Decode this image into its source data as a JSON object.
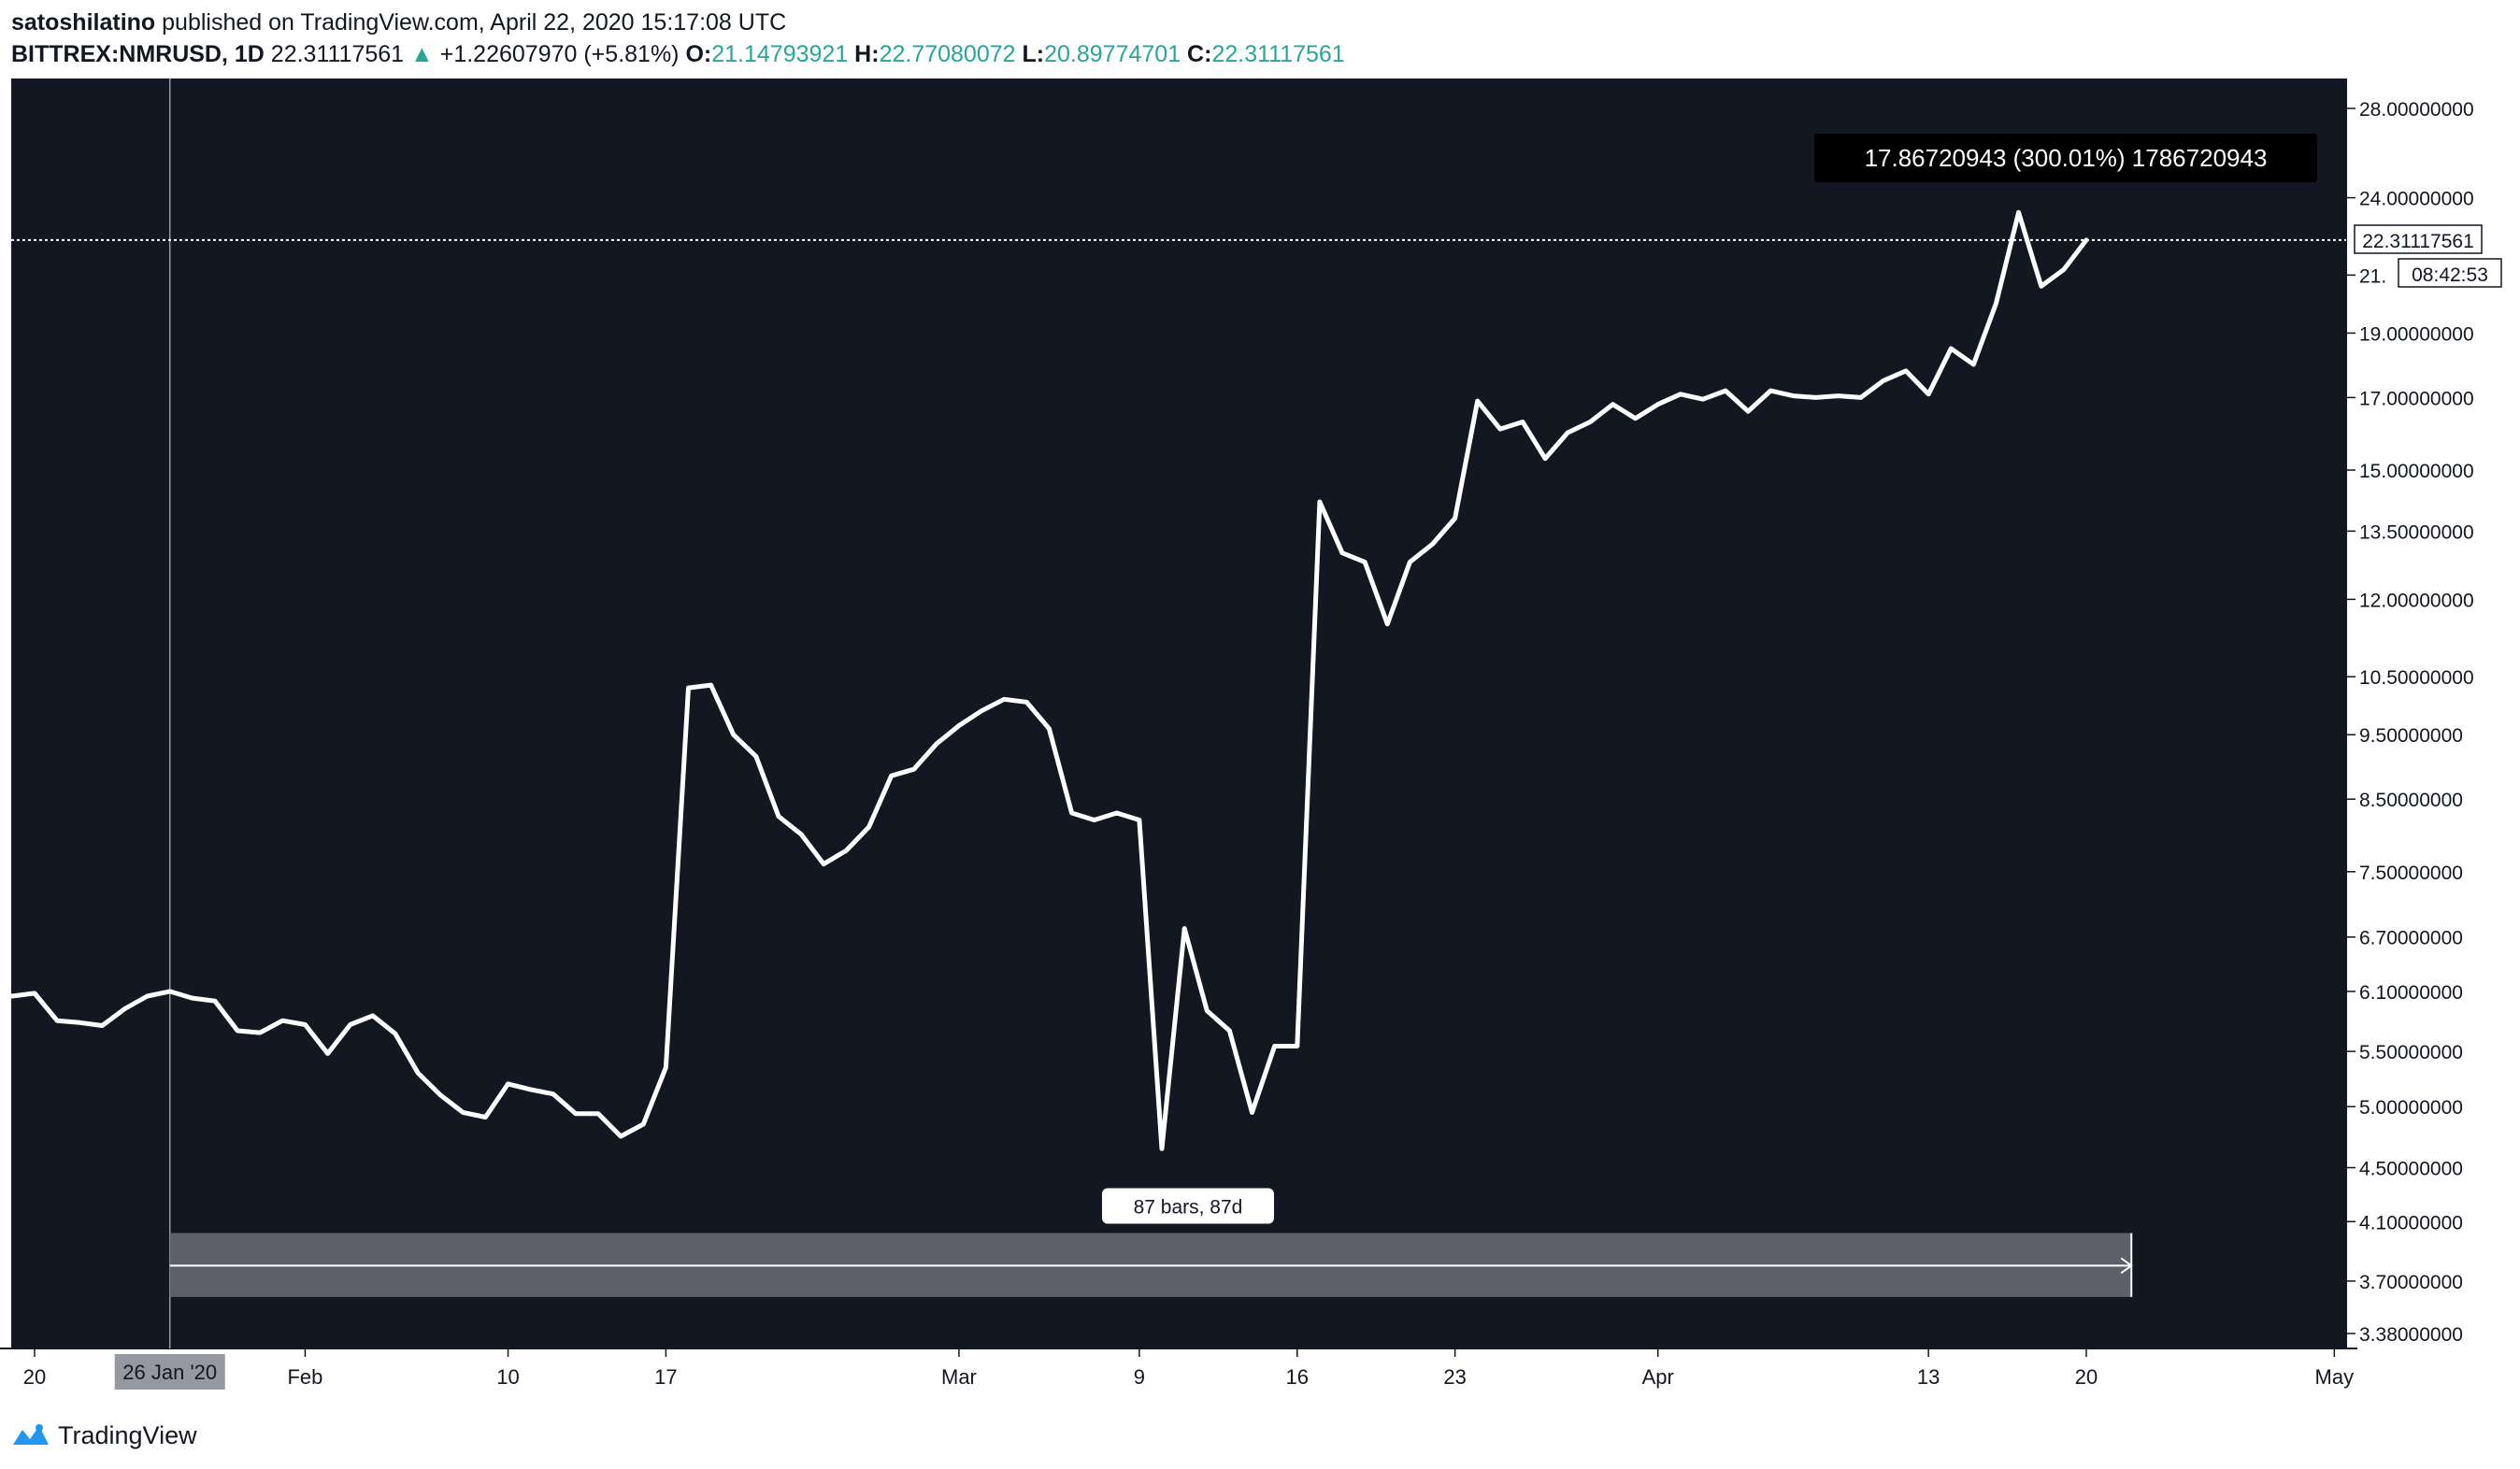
{
  "header": {
    "author": "satoshilatino",
    "published_text": "published on TradingView.com, April 22, 2020 15:17:08 UTC",
    "symbol": "BITTREX:NMRUSD, 1D",
    "last": "22.31117561",
    "change": "+1.22607970 (+5.81%)",
    "o_label": "O:",
    "o_value": "21.14793921",
    "h_label": "H:",
    "h_value": "22.77080072",
    "l_label": "L:",
    "l_value": "20.89774701",
    "c_label": "C:",
    "c_value": "22.31117561"
  },
  "footer": {
    "brand": "TradingView"
  },
  "colors": {
    "chart_bg": "#131722",
    "line": "#ffffff",
    "axis_bg": "#ffffff",
    "positive": "#26a69a",
    "range_fill": "#5d606b",
    "tooltip_bg": "#000000"
  },
  "chart_data": {
    "type": "line",
    "title": "BITTREX:NMRUSD, 1D",
    "xlabel": "",
    "ylabel": "",
    "y_scale": "log",
    "ylim": [
      3.3,
      32
    ],
    "grid": false,
    "x_dates": [
      "2020-01-17",
      "2020-01-18",
      "2020-01-19",
      "2020-01-20",
      "2020-01-21",
      "2020-01-22",
      "2020-01-23",
      "2020-01-24",
      "2020-01-25",
      "2020-01-26",
      "2020-01-27",
      "2020-01-28",
      "2020-01-29",
      "2020-01-30",
      "2020-01-31",
      "2020-02-01",
      "2020-02-02",
      "2020-02-03",
      "2020-02-04",
      "2020-02-05",
      "2020-02-06",
      "2020-02-07",
      "2020-02-08",
      "2020-02-09",
      "2020-02-10",
      "2020-02-11",
      "2020-02-12",
      "2020-02-13",
      "2020-02-14",
      "2020-02-15",
      "2020-02-16",
      "2020-02-17",
      "2020-02-18",
      "2020-02-19",
      "2020-02-20",
      "2020-02-21",
      "2020-02-22",
      "2020-02-23",
      "2020-02-24",
      "2020-02-25",
      "2020-02-26",
      "2020-02-27",
      "2020-02-28",
      "2020-02-29",
      "2020-03-01",
      "2020-03-02",
      "2020-03-03",
      "2020-03-04",
      "2020-03-05",
      "2020-03-06",
      "2020-03-07",
      "2020-03-08",
      "2020-03-09",
      "2020-03-10",
      "2020-03-11",
      "2020-03-12",
      "2020-03-13",
      "2020-03-14",
      "2020-03-15",
      "2020-03-16",
      "2020-03-17",
      "2020-03-18",
      "2020-03-19",
      "2020-03-20",
      "2020-03-21",
      "2020-03-22",
      "2020-03-23",
      "2020-03-24",
      "2020-03-25",
      "2020-03-26",
      "2020-03-27",
      "2020-03-28",
      "2020-03-29",
      "2020-03-30",
      "2020-03-31",
      "2020-04-01",
      "2020-04-02",
      "2020-04-03",
      "2020-04-04",
      "2020-04-05",
      "2020-04-06",
      "2020-04-07",
      "2020-04-08",
      "2020-04-09",
      "2020-04-10",
      "2020-04-11",
      "2020-04-12",
      "2020-04-13",
      "2020-04-14",
      "2020-04-15",
      "2020-04-16",
      "2020-04-17",
      "2020-04-18",
      "2020-04-19",
      "2020-04-20",
      "2020-04-21",
      "2020-04-22"
    ],
    "series": [
      {
        "values": [
          6.2,
          6.1,
          6.05,
          6.08,
          5.8,
          5.78,
          5.75,
          5.92,
          6.05,
          6.1,
          6.03,
          6.0,
          5.7,
          5.68,
          5.8,
          5.76,
          5.48,
          5.76,
          5.85,
          5.67,
          5.3,
          5.1,
          4.95,
          4.91,
          5.2,
          5.15,
          5.11,
          4.94,
          4.94,
          4.75,
          4.85,
          5.35,
          10.3,
          10.35,
          9.5,
          9.15,
          8.25,
          8.0,
          7.6,
          7.78,
          8.1,
          8.85,
          8.95,
          9.35,
          9.65,
          9.9,
          10.1,
          10.05,
          9.6,
          8.3,
          8.2,
          8.3,
          8.2,
          4.65,
          6.8,
          5.9,
          5.7,
          4.95,
          5.55,
          5.55,
          14.2,
          13.0,
          12.8,
          11.5,
          12.8,
          13.2,
          13.8,
          16.9,
          16.1,
          16.3,
          15.3,
          16.0,
          16.3,
          16.8,
          16.4,
          16.8,
          17.1,
          16.95,
          17.2,
          16.6,
          17.2,
          17.05,
          17.0,
          17.05,
          17.0,
          17.5,
          17.8,
          17.1,
          18.5,
          18.0,
          20.0,
          23.4,
          20.6,
          21.2,
          22.31
        ]
      }
    ],
    "price_axis_labels": [
      "28.00000000",
      "24.00000000",
      "21.",
      "19.00000000",
      "17.00000000",
      "15.00000000",
      "13.50000000",
      "12.00000000",
      "10.50000000",
      "9.50000000",
      "8.50000000",
      "7.50000000",
      "6.70000000",
      "6.10000000",
      "5.50000000",
      "5.00000000",
      "4.50000000",
      "4.10000000",
      "3.70000000",
      "3.38000000"
    ],
    "price_axis_values": [
      28.0,
      24.0,
      21.0,
      19.0,
      17.0,
      15.0,
      13.5,
      12.0,
      10.5,
      9.5,
      8.5,
      7.5,
      6.7,
      6.1,
      5.5,
      5.0,
      4.5,
      4.1,
      3.7,
      3.38
    ],
    "time_axis_labels": [
      "20",
      "Feb",
      "10",
      "17",
      "Mar",
      "9",
      "16",
      "23",
      "Apr",
      "13",
      "20",
      "May"
    ],
    "time_axis_dates": [
      "2020-01-20",
      "2020-02-01",
      "2020-02-10",
      "2020-02-17",
      "2020-03-01",
      "2020-03-09",
      "2020-03-16",
      "2020-03-23",
      "2020-04-01",
      "2020-04-13",
      "2020-04-20",
      "2020-05-01"
    ],
    "crosshair_time_label": "26 Jan '20",
    "crosshair_date": "2020-01-26",
    "last_price_label": "22.31117561",
    "countdown_label": "08:42:53",
    "last_price": 22.31117561,
    "measure": {
      "start_date": "2020-01-26",
      "end_date": "2020-04-22",
      "price_low": 3.6,
      "price_high": 4.02,
      "price_mid": 3.8,
      "bars_label": "87 bars, 87d",
      "delta_label": "17.86720943 (300.01%) 1786720943"
    }
  }
}
